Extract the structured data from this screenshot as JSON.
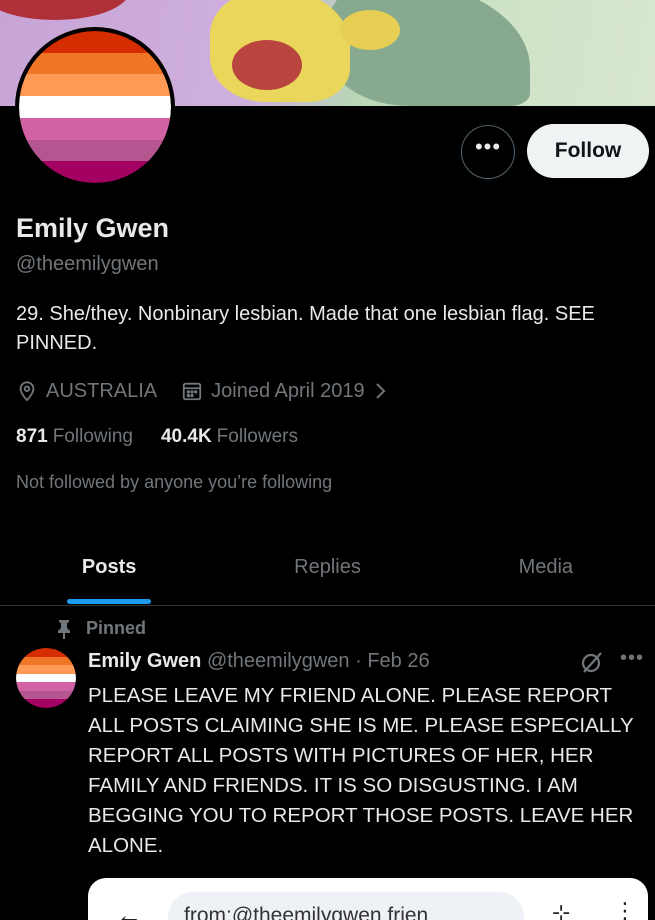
{
  "profile": {
    "name": "Emily Gwen",
    "handle": "@theemilygwen",
    "bio": "29. She/they. Nonbinary lesbian. Made that one lesbian flag. SEE PINNED.",
    "location": "AUSTRALIA",
    "joined": "Joined April 2019",
    "following_count": "871",
    "following_label": "Following",
    "followers_count": "40.4K",
    "followers_label": "Followers",
    "not_followed_text": "Not followed by anyone you’re following"
  },
  "actions": {
    "more_icon": "more-icon",
    "more_label": "•••",
    "follow_label": "Follow"
  },
  "flag_colors": [
    "#d52d00",
    "#ef7627",
    "#ff9a56",
    "#ffffff",
    "#d162a4",
    "#b55690",
    "#a30262"
  ],
  "tabs": [
    {
      "label": "Posts",
      "active": true
    },
    {
      "label": "Replies",
      "active": false
    },
    {
      "label": "Media",
      "active": false
    }
  ],
  "pinned_post": {
    "pinned_label": "Pinned",
    "author_name": "Emily Gwen",
    "author_handle": "@theemilygwen",
    "separator": "·",
    "date": "Feb 26",
    "dots_label": "•••",
    "text": "PLEASE LEAVE MY FRIEND ALONE. PLEASE REPORT ALL POSTS CLAIMING SHE IS ME. PLEASE ESPECIALLY REPORT ALL POSTS WITH PICTURES OF HER, HER FAMILY AND FRIENDS. IT IS SO DISGUSTING. I AM BEGGING YOU TO REPORT THOSE POSTS. LEAVE HER ALONE.",
    "embed": {
      "back_label": "←",
      "search_text": "from:@theemilygwen frien",
      "filter_label": "⊹",
      "more_label": "⋮"
    }
  },
  "colors": {
    "accent": "#1d9bf0",
    "background": "#000000",
    "text": "#e7e9ea",
    "muted": "#71767b"
  }
}
